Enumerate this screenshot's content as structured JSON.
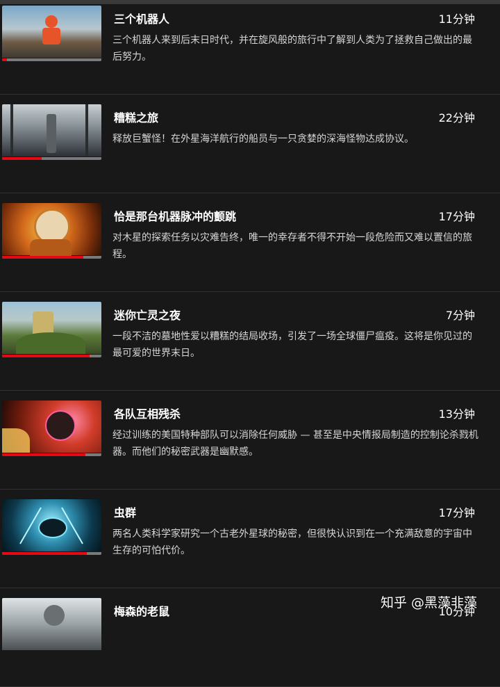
{
  "episodes": [
    {
      "title": "三个机器人",
      "duration": "11分钟",
      "description": "三个机器人来到后末日时代，并在旋风般的旅行中了解到人类为了拯救自己做出的最后努力。",
      "progress": 0.05
    },
    {
      "title": "糟糕之旅",
      "duration": "22分钟",
      "description": "释放巨蟹怪！在外星海洋航行的船员与一只贪婪的深海怪物达成协议。",
      "progress": 0.4
    },
    {
      "title": "恰是那台机器脉冲的颤跳",
      "duration": "17分钟",
      "description": "对木星的探索任务以灾难告终，唯一的幸存者不得不开始一段危险而又难以置信的旅程。",
      "progress": 0.82
    },
    {
      "title": "迷你亡灵之夜",
      "duration": "7分钟",
      "description": "一段不洁的墓地性爱以糟糕的结局收场，引发了一场全球僵尸瘟疫。这将是你见过的最可爱的世界末日。",
      "progress": 0.88
    },
    {
      "title": "各队互相残杀",
      "duration": "13分钟",
      "description": "经过训练的美国特种部队可以消除任何威胁 — 甚至是中央情报局制造的控制论杀戮机器。而他们的秘密武器是幽默感。",
      "progress": 0.84
    },
    {
      "title": "虫群",
      "duration": "17分钟",
      "description": "两名人类科学家研究一个古老外星球的秘密，但很快认识到在一个充满敌意的宇宙中生存的可怕代价。",
      "progress": 0.85
    },
    {
      "title": "梅森的老鼠",
      "duration": "10分钟",
      "description": "",
      "progress": 0
    }
  ],
  "watermark": "知乎 @黑藻非藻"
}
